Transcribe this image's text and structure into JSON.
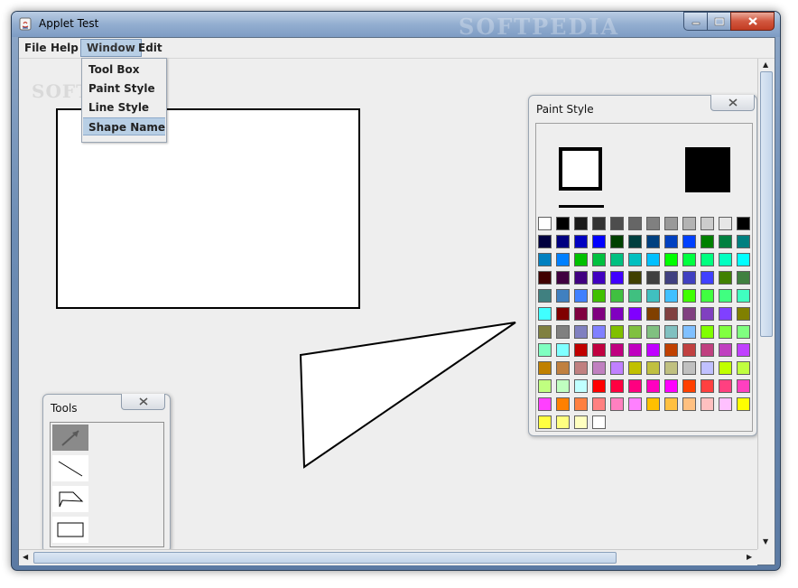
{
  "window": {
    "title": "Applet Test",
    "watermark": "SOFTPEDIA"
  },
  "menubar": {
    "items": [
      {
        "label": "File",
        "active": false
      },
      {
        "label": "Help",
        "active": false
      },
      {
        "label": "Window",
        "active": true
      },
      {
        "label": "Edit",
        "active": false
      }
    ]
  },
  "window_menu": {
    "items": [
      {
        "label": "Tool Box",
        "selected": false
      },
      {
        "label": "Paint Style",
        "selected": false
      },
      {
        "label": "Line Style",
        "selected": false
      },
      {
        "label": "Shape Name",
        "selected": true
      }
    ]
  },
  "canvas": {
    "watermark": "SOFTPEDIA"
  },
  "tools_frame": {
    "title": "Tools",
    "tools": [
      {
        "icon": "arrow-select-icon",
        "selected": true
      },
      {
        "icon": "line-tool-icon",
        "selected": false
      },
      {
        "icon": "polygon-tool-icon",
        "selected": false
      },
      {
        "icon": "rectangle-tool-icon",
        "selected": false
      }
    ]
  },
  "paint_style_frame": {
    "title": "Paint Style",
    "stroke_color": "#000000",
    "fill_color": "#000000",
    "palette": [
      [
        "#ffffff",
        "#000000",
        "#1a1a1a",
        "#333333",
        "#4d4d4d",
        "#666666",
        "#808080",
        "#999999",
        "#b3b3b3",
        "#cccccc",
        "#e6e6e6",
        "#000000"
      ],
      [
        "#000040",
        "#000080",
        "#0000c0",
        "#0000ff",
        "#004000",
        "#004040",
        "#004080",
        "#0040c0",
        "#0040ff",
        "#008000",
        "#008040",
        "#008080"
      ],
      [
        "#0080c0",
        "#0080ff",
        "#00c000",
        "#00c040",
        "#00c080",
        "#00c0c0",
        "#00c0ff",
        "#00ff00",
        "#00ff40",
        "#00ff80",
        "#00ffc0",
        "#00ffff"
      ],
      [
        "#400000",
        "#400040",
        "#400080",
        "#4000c0",
        "#4000ff",
        "#404000",
        "#404040",
        "#404080",
        "#4040c0",
        "#4040ff",
        "#408000",
        "#408040"
      ],
      [
        "#408080",
        "#4080c0",
        "#4080ff",
        "#40c000",
        "#40c040",
        "#40c080",
        "#40c0c0",
        "#40c0ff",
        "#40ff00",
        "#40ff40",
        "#40ff80",
        "#40ffc0"
      ],
      [
        "#40ffff",
        "#800000",
        "#800040",
        "#800080",
        "#8000c0",
        "#8000ff",
        "#804000",
        "#804040",
        "#804080",
        "#8040c0",
        "#8040ff",
        "#808000"
      ],
      [
        "#808040",
        "#808080",
        "#8080c0",
        "#8080ff",
        "#80c000",
        "#80c040",
        "#80c080",
        "#80c0c0",
        "#80c0ff",
        "#80ff00",
        "#80ff40",
        "#80ff80"
      ],
      [
        "#80ffc0",
        "#80ffff",
        "#c00000",
        "#c00040",
        "#c00080",
        "#c000c0",
        "#c000ff",
        "#c04000",
        "#c04040",
        "#c04080",
        "#c040c0",
        "#c040ff"
      ],
      [
        "#c08000",
        "#c08040",
        "#c08080",
        "#c080c0",
        "#c080ff",
        "#c0c000",
        "#c0c040",
        "#c0c080",
        "#c0c0c0",
        "#c0c0ff",
        "#c0ff00",
        "#c0ff40"
      ],
      [
        "#c0ff80",
        "#c0ffc0",
        "#c0ffff",
        "#ff0000",
        "#ff0040",
        "#ff0080",
        "#ff00c0",
        "#ff00ff",
        "#ff4000",
        "#ff4040",
        "#ff4080",
        "#ff40c0"
      ],
      [
        "#ff40ff",
        "#ff8000",
        "#ff8040",
        "#ff8080",
        "#ff80c0",
        "#ff80ff",
        "#ffc000",
        "#ffc040",
        "#ffc080",
        "#ffc0c0",
        "#ffc0ff",
        "#ffff00"
      ],
      [
        "#ffff40",
        "#ffff80",
        "#ffffc0",
        "#ffffff"
      ]
    ]
  }
}
